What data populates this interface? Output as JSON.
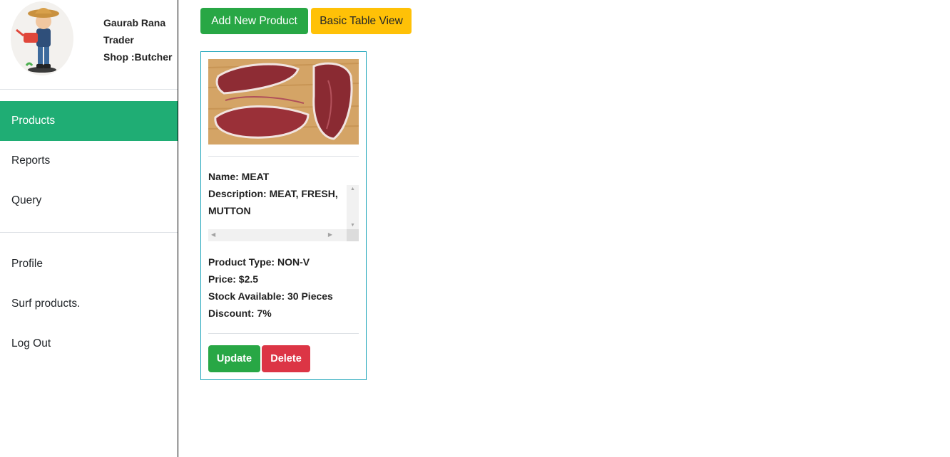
{
  "user": {
    "name": "Gaurab Rana",
    "role": "Trader",
    "shop": "Shop :Butcher"
  },
  "nav": {
    "main": [
      {
        "label": "Products",
        "active": true
      },
      {
        "label": "Reports",
        "active": false
      },
      {
        "label": "Query",
        "active": false
      }
    ],
    "secondary": [
      {
        "label": "Profile"
      },
      {
        "label": "Surf products."
      },
      {
        "label": "Log Out"
      }
    ]
  },
  "toolbar": {
    "add_label": "Add New Product",
    "table_view_label": "Basic Table View"
  },
  "product": {
    "name_line": "Name: MEAT",
    "description_line": "Description: MEAT, FRESH, MUTTON",
    "type_line": "Product Type: NON-V",
    "price_line": "Price: $2.5",
    "stock_line": "Stock Available: 30 Pieces",
    "discount_line": "Discount: 7%",
    "update_label": "Update",
    "delete_label": "Delete"
  },
  "colors": {
    "active_nav": "#1fad74",
    "success": "#28a745",
    "warning": "#ffc107",
    "danger": "#dc3545",
    "card_border": "#17a2b8"
  },
  "icons": {
    "avatar": "farmer-avatar",
    "product_image": "meat-photo"
  }
}
